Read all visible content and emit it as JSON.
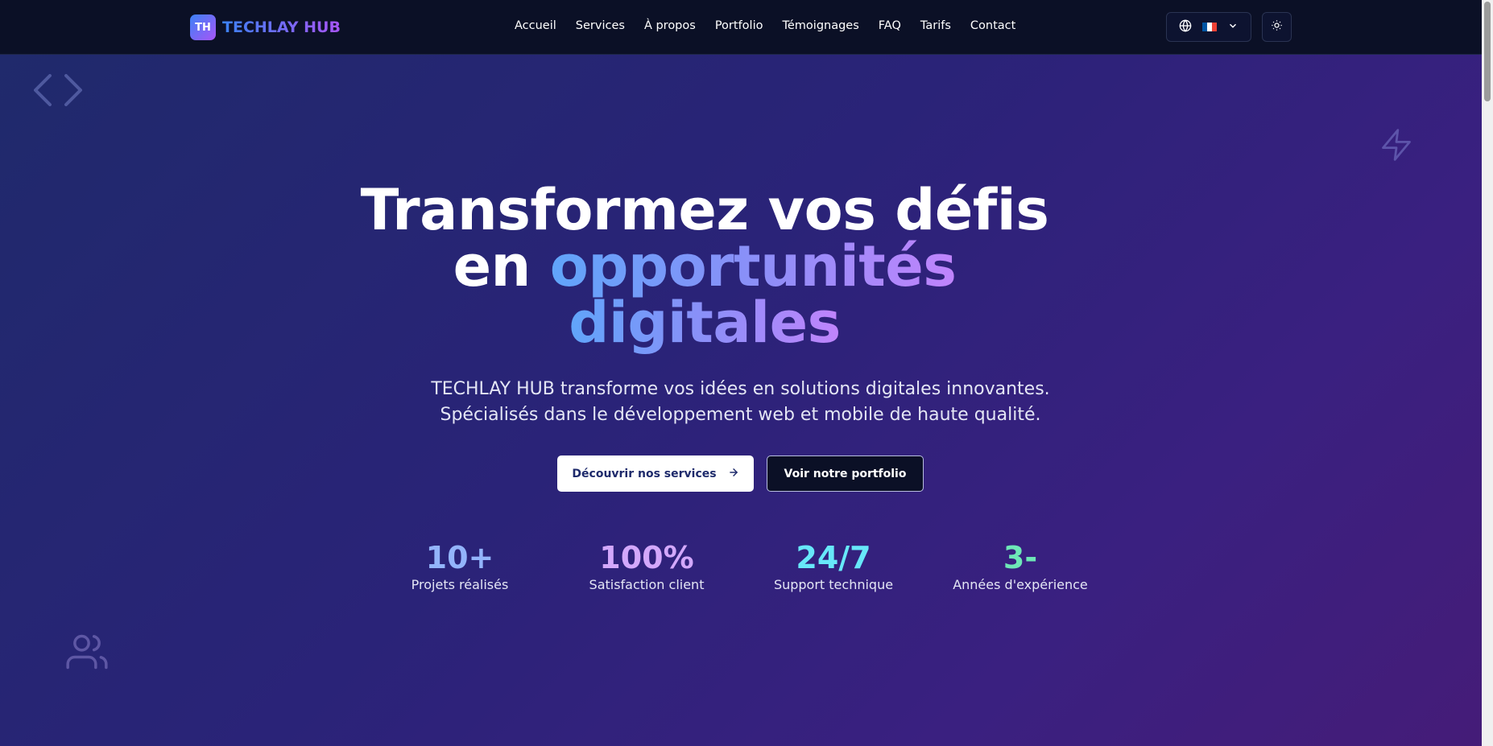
{
  "brand": {
    "mark": "TH",
    "name": "TECHLAY HUB"
  },
  "nav": {
    "links": [
      "Accueil",
      "Services",
      "À propos",
      "Portfolio",
      "Témoignages",
      "FAQ",
      "Tarifs",
      "Contact"
    ]
  },
  "language": {
    "icon": "globe-icon",
    "flag": "french-flag",
    "dropdown_icon": "chevron-down-icon"
  },
  "theme_toggle": {
    "icon": "sun-icon"
  },
  "hero": {
    "title_line1": "Transformez vos défis",
    "title_line2_prefix": "en ",
    "title_line2_highlight": "opportunités",
    "title_line3": "digitales",
    "subtitle": "TECHLAY HUB transforme vos idées en solutions digitales innovantes. Spécialisés dans le développement web et mobile de haute qualité.",
    "primary_cta": "Découvrir nos services",
    "secondary_cta": "Voir notre portfolio"
  },
  "stats": [
    {
      "value": "10+",
      "label": "Projets réalisés",
      "color": "#93b4fb"
    },
    {
      "value": "100%",
      "label": "Satisfaction client",
      "color": "#d3a8fb"
    },
    {
      "value": "24/7",
      "label": "Support technique",
      "color": "#67e8f9"
    },
    {
      "value": "3-",
      "label": "Années d'expérience",
      "color": "#6ee7b7"
    }
  ],
  "colors": {
    "nav_bg": "#0b1026",
    "accent_blue": "#3b82f6",
    "accent_purple": "#a855f7"
  },
  "decorations": [
    "code-icon",
    "zap-icon",
    "users-icon"
  ]
}
